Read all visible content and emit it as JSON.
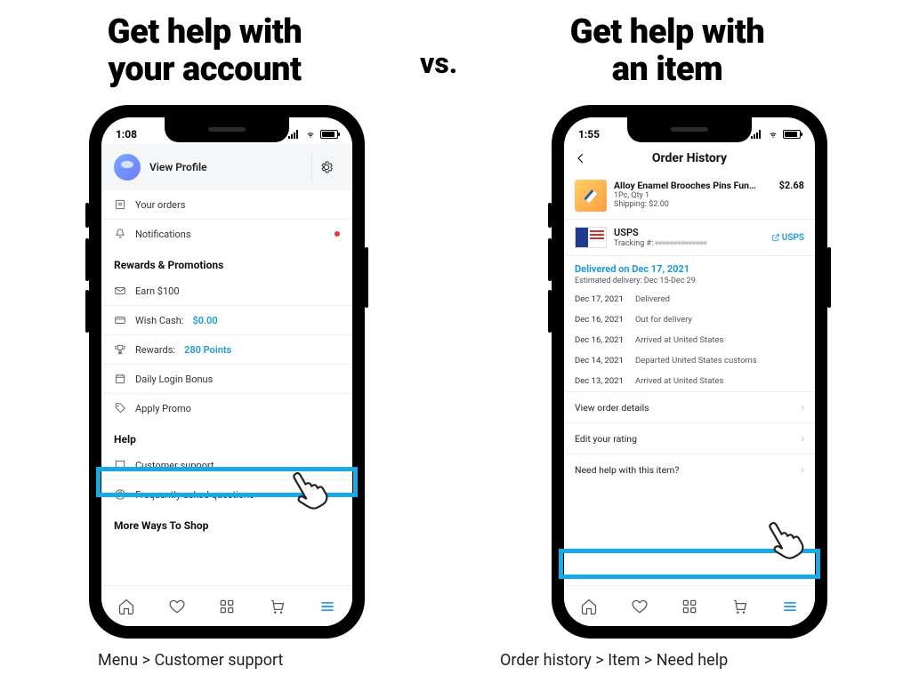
{
  "vs_label": "vs.",
  "left": {
    "heading_line1": "Get help with",
    "heading_line2": "your account",
    "breadcrumb": "Menu > Customer support",
    "status_time": "1:08",
    "profile": {
      "view_profile": "View Profile"
    },
    "rows": {
      "your_orders": "Your orders",
      "notifications": "Notifications"
    },
    "rewards_section": "Rewards & Promotions",
    "rewards": {
      "earn": "Earn $100",
      "wish_cash_label": "Wish Cash:",
      "wish_cash_value": "$0.00",
      "rewards_label": "Rewards:",
      "rewards_value": "280 Points",
      "daily_login": "Daily Login Bonus",
      "apply_promo": "Apply Promo"
    },
    "help_section": "Help",
    "help": {
      "customer_support": "Customer support",
      "faq": "Frequently asked questions"
    },
    "more_section": "More Ways To Shop"
  },
  "right": {
    "heading_line1": "Get help with",
    "heading_line2": "an item",
    "breadcrumb": "Order history > Item > Need help",
    "status_time": "1:55",
    "title": "Order History",
    "item": {
      "name": "Alloy Enamel Brooches Pins Fun…",
      "qty": "1Pc, Qty 1",
      "shipping": "Shipping: $2.00",
      "price": "$2.68"
    },
    "carrier": {
      "name": "USPS",
      "tracking_label": "Tracking #:",
      "link": "USPS"
    },
    "delivery": {
      "main": "Delivered on Dec 17, 2021",
      "est": "Estimated delivery: Dec 15-Dec 29"
    },
    "timeline": [
      {
        "date": "Dec 17, 2021",
        "status": "Delivered"
      },
      {
        "date": "Dec 16, 2021",
        "status": "Out for delivery"
      },
      {
        "date": "Dec 16, 2021",
        "status": "Arrived at United States"
      },
      {
        "date": "Dec 14, 2021",
        "status": "Departed United States customs"
      },
      {
        "date": "Dec 13, 2021",
        "status": "Arrived at United States"
      }
    ],
    "actions": {
      "view_details": "View order details",
      "edit_rating": "Edit your rating",
      "need_help": "Need help with this item?"
    }
  }
}
